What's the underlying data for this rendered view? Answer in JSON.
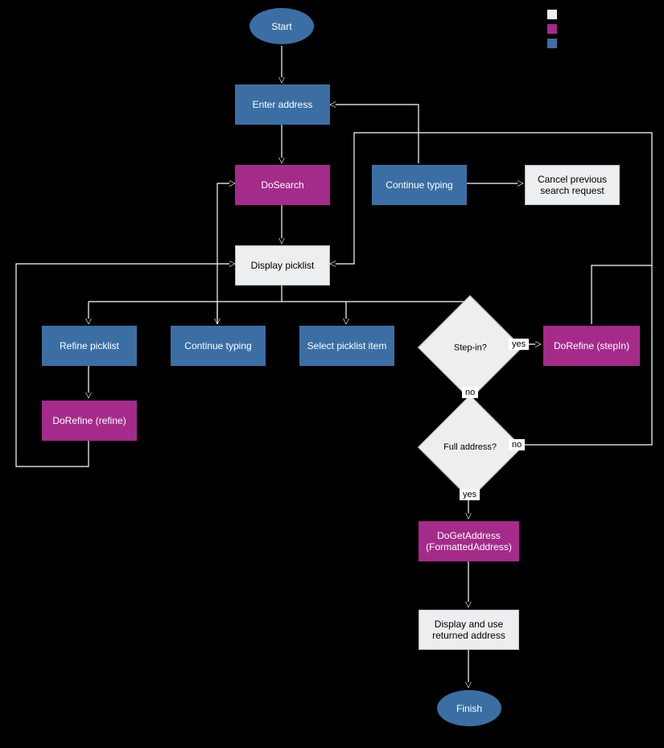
{
  "nodes": {
    "start": "Start",
    "enter_address": "Enter address",
    "do_search": "DoSearch",
    "continue_typing_top": "Continue typing",
    "cancel_previous": "Cancel previous search request",
    "display_picklist": "Display picklist",
    "refine_picklist": "Refine picklist",
    "continue_typing_left": "Continue typing",
    "select_picklist_item": "Select picklist item",
    "step_in": "Step-in?",
    "do_refine_stepin": "DoRefine (stepIn)",
    "do_refine_refine": "DoRefine (refine)",
    "full_address": "Full address?",
    "do_get_address": "DoGetAddress (FormattedAddress)",
    "display_use": "Display and use returned address",
    "finish": "Finish"
  },
  "labels": {
    "yes": "yes",
    "no": "no"
  },
  "legend": {
    "white": "",
    "purple": "",
    "blue": ""
  },
  "colors": {
    "blue": "#3b6fa3",
    "purple": "#a42b8a",
    "white": "#eceef0"
  }
}
